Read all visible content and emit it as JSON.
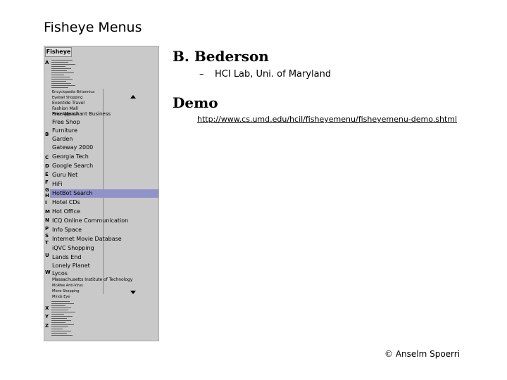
{
  "slide": {
    "title": "Fisheye Menus",
    "footer": "© Anselm Spoerri"
  },
  "bullets": [
    {
      "heading": "B. Bederson",
      "dash": "–",
      "sub": "HCI Lab, Uni. of Maryland"
    },
    {
      "heading": "Demo",
      "link": "http://www.cs.umd.edu/hcil/fisheyemenu/fisheyemenu-demo.shtml"
    }
  ],
  "menu": {
    "header": "Fisheye",
    "letters": [
      "A",
      "B",
      "C",
      "D",
      "E",
      "F",
      "G",
      "H",
      "I",
      "M",
      "N",
      "P",
      "S",
      "T",
      "U",
      "W",
      "X",
      "Y",
      "Z"
    ],
    "items": [
      "Encyclopedia Britannica",
      "Eyeball Shopping",
      "Eventide Travel",
      "Fashion Mall",
      "Fine Apparel",
      "Free Merchant Business",
      "Free Shop",
      "Furniture",
      "Garden",
      "Gateway 2000",
      "Georgia Tech",
      "Google Search",
      "Guru Net",
      "HiFi",
      "HotBot Search",
      "Hotel CDs",
      "Hot Office",
      "ICQ Online Communication",
      "Info Space",
      "Internet Movie Database",
      "iQVC Shopping",
      "Lands End",
      "Lonely Planet",
      "Lycos",
      "Massachusetts Institute of Technology",
      "McAfee Anti-Virus",
      "Micro Shopping",
      "Minds Eye"
    ],
    "selected": "HotBot Search"
  }
}
